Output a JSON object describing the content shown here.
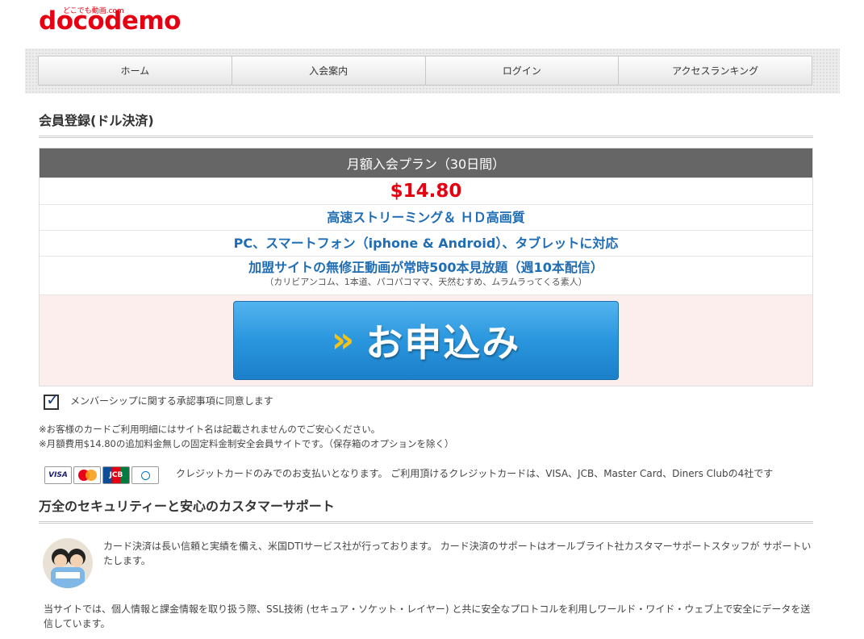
{
  "brand": {
    "tagline": "どこでも動画.com",
    "logo": "docodemo"
  },
  "nav": [
    {
      "label": "ホーム"
    },
    {
      "label": "入会案内"
    },
    {
      "label": "ログイン"
    },
    {
      "label": "アクセスランキング"
    }
  ],
  "registration": {
    "title": "会員登録(ドル決済)"
  },
  "plan": {
    "header": "月額入会プラン（30日間）",
    "price": "$14.80",
    "feature1": "高速ストリーミング＆ ＨＤ高画質",
    "feature2": "PC、スマートフォン（iphone & Android）、タブレットに対応",
    "feature3": "加盟サイトの無修正動画が常時500本見放題（週10本配信）",
    "feature3_sub": "（カリビアンコム、1本道、パコパコママ、天然むすめ、ムラムラってくる素人）",
    "apply_arrows": "»",
    "apply_label": "お申込み"
  },
  "agreement": {
    "checked": true,
    "label": "メンバーシップに関する承認事項に同意します"
  },
  "notes": {
    "line1": "※お客様のカードご利用明細にはサイト名は記載されませんのでご安心ください。",
    "line2": "※月額費用$14.80の追加料金無しの固定料金制安全会員サイトです。（保存箱のオプションを除く）"
  },
  "cards": {
    "visa": "VISA",
    "mastercard": "MasterCard",
    "jcb": "JCB",
    "diners": "Diners Club",
    "text": "クレジットカードのみでのお支払いとなります。 ご利用頂けるクレジットカードは、VISA、JCB、Master Card、Diners Clubの4社です"
  },
  "security": {
    "title": "万全のセキュリティーと安心のカスタマーサポート",
    "avatar_label": "Allbright",
    "support": "カード決済は長い信頼と実績を備え、米国DTIサービス社が行っております。 カード決済のサポートはオールブライト社カスタマーサポートスタッフが サポートいたします。",
    "ssl": "当サイトでは、個人情報と課金情報を取り扱う際、SSL技術 (セキュア・ソケット・レイヤー) と共に安全なプロトコルを利用しワールド・ワイド・ウェブ上で安全にデータを送信しています。"
  },
  "colors": {
    "brand_red": "#e50012",
    "feature_blue": "#1f6db5",
    "button_blue": "#2a96dd",
    "header_gray": "#666666"
  }
}
